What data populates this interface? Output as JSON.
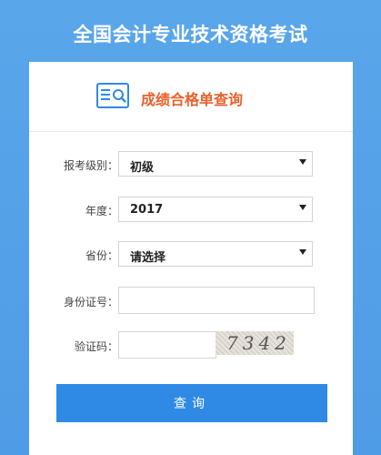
{
  "page": {
    "title": "全国会计专业技术资格考试"
  },
  "card": {
    "header": {
      "icon": "report-search-icon",
      "title": "成绩合格单查询"
    }
  },
  "form": {
    "level": {
      "label": "报考级别：",
      "value": "初级"
    },
    "year": {
      "label": "年度：",
      "value": "2017"
    },
    "province": {
      "label": "省份：",
      "value": "请选择"
    },
    "id_number": {
      "label": "身份证号：",
      "value": "",
      "placeholder": ""
    },
    "captcha": {
      "label": "验证码：",
      "value": "",
      "image_text": "7342"
    },
    "submit_label": "查询"
  },
  "colors": {
    "background": "#5aa6ea",
    "accent_orange": "#e8612a",
    "button_blue": "#2f8ae6"
  }
}
